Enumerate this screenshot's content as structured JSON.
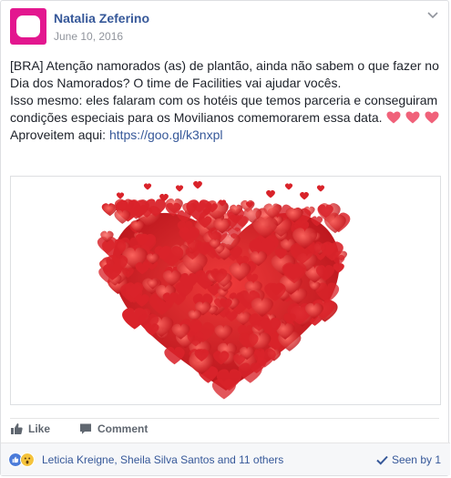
{
  "post": {
    "author": "Natalia Zeferino",
    "date": "June 10, 2016",
    "text_line1": "[BRA] Atenção namorados (as) de plantão, ainda não sabem o que fazer no Dia dos Namorados? O time de Facilities vai ajudar vocês.",
    "text_line2": "Isso mesmo: eles falaram com os hotéis que temos parceria e conseguiram condições especiais para os Movilianos comemorarem essa data.",
    "text_line3_prefix": "Aproveitem aqui: ",
    "link": "https://goo.gl/k3nxpl",
    "emoji_hearts": [
      "heart-emoji",
      "heart-emoji",
      "heart-emoji"
    ],
    "image_icon": "red-heart-made-of-hearts"
  },
  "actions": {
    "like_label": "Like",
    "comment_label": "Comment"
  },
  "reactions": {
    "icons": [
      "like-icon",
      "wow-icon"
    ],
    "names": "Leticia Kreigne, Sheila Silva Santos and 11 others",
    "seen_label": "Seen by 1"
  },
  "colors": {
    "avatar": "#e3178f",
    "link": "#365899",
    "heart": "#d9232a",
    "emoji_heart": "#f0627a"
  }
}
